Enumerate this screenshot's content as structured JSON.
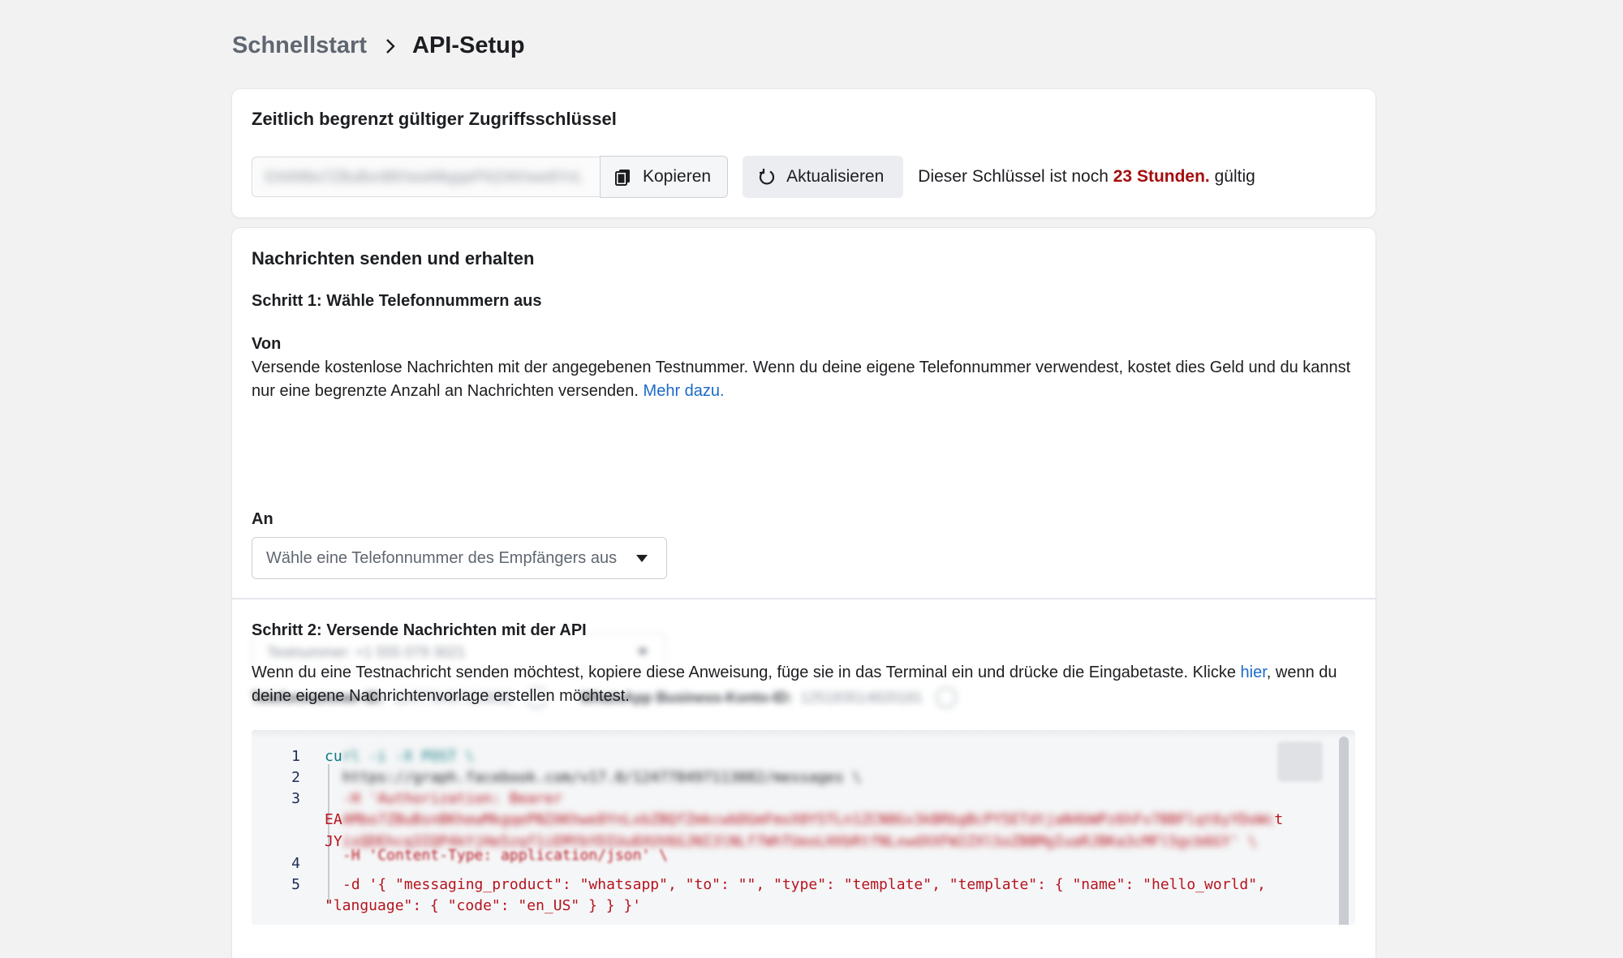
{
  "breadcrumb": {
    "parent": "Schnellstart",
    "current": "API-Setup"
  },
  "token_card": {
    "title": "Zeitlich begrenzt gültiger Zugriffsschlüssel",
    "token_value": "EAAMbo7ZBuBsnBKhewMkgqePNZAKhwe8YnLxbZBQ",
    "copy_label": "Kopieren",
    "refresh_label": "Aktualisieren",
    "validity_prefix": "Dieser Schlüssel ist noch",
    "validity_hours": "23 Stunden.",
    "validity_suffix": "gültig"
  },
  "messages_card": {
    "title": "Nachrichten senden und erhalten",
    "step1_title": "Schritt 1: Wähle Telefonnummern aus",
    "from_label": "Von",
    "from_text": "Versende kostenlose Nachrichten mit der angegebenen Testnummer. Wenn du deine eigene Telefonnummer verwendest, kostet dies Geld und du kannst nur eine begrenzte Anzahl an Nachrichten versenden.",
    "from_link": "Mehr dazu.",
    "from_select_value": "Testnummer: +1 555 079 3021",
    "phone_id_label": "Telefonnummer-ID:",
    "phone_id_value": "124778497113082",
    "waba_id_label": "WhatsApp Business-Konto-ID:",
    "waba_id_value": "125183514820181",
    "to_label": "An",
    "to_placeholder": "Wähle eine Telefonnummer des Empfängers aus",
    "step2_title": "Schritt 2: Versende Nachrichten mit der API",
    "step2_text_before": "Wenn du eine Testnachricht senden möchtest, kopiere diese Anweisung, füge sie in das Terminal ein und drücke die Eingabetaste. Klicke",
    "step2_link": "hier",
    "step2_text_after": ", wenn du deine eigene Nachrichtenvorlage erstellen möchtest."
  },
  "code": {
    "line_numbers": [
      "1",
      "2",
      "3",
      "4",
      "5"
    ],
    "l1_start": "cu",
    "l1_rest": "rl -i -X POST \\",
    "l2": "https://graph.facebook.com/v17.0/124778497113082/messages \\",
    "l3": "-H 'Authorization: Bearer",
    "l3b_start": "EA",
    "l3b_rest": "AMbo7ZBuBsnBKhewMkgqePNZAKhwe8YnLxbZBQfZmkcwbDGmFmxX0Y5TLn1ZCN0Gv3kBRbgBcPY5ETdtjaN4bWPz6hFv7BBFlqt6yYDoWc",
    "l3b_end": "t",
    "l3c_start": "JY",
    "l3c_rest": "isQDEhcq3IQP4kYjHe5zqf1iEMYbYDIUu8XUV6GJNI3lNLf7WhTUeoLHXbRtfNLxwdXXFW2ZXlSoZBBMgIuaRJBKa3cMFl5gcb6GY' \\",
    "l4": "-H 'Content-Type: application/json' \\",
    "l5": "-d '{ \"messaging_product\": \"whatsapp\", \"to\": \"\", \"type\": \"template\", \"template\": { \"name\": \"hello_world\",",
    "l6": "\"language\": { \"code\": \"en_US\" } } }'"
  }
}
